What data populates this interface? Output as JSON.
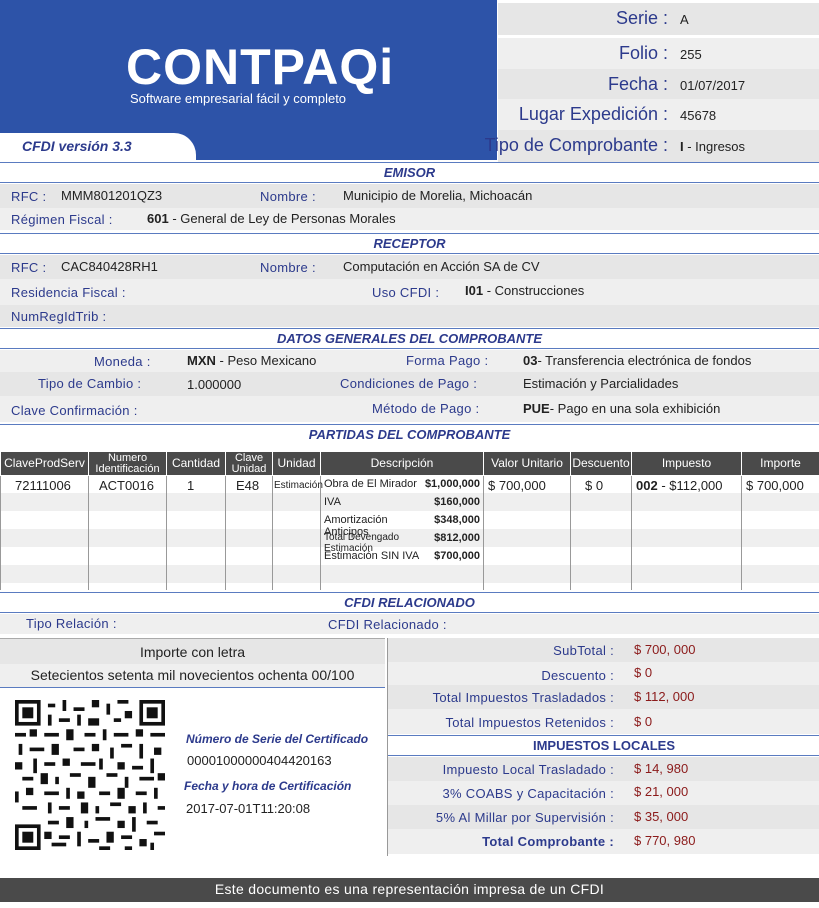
{
  "header": {
    "logo": "CONTPAQi",
    "tagline": "Software empresarial fácil y completo",
    "cfdi_version": "CFDI versión 3.3",
    "fields": [
      {
        "label": "Serie :",
        "value": "A"
      },
      {
        "label": "Folio :",
        "value": "255"
      },
      {
        "label": "Fecha :",
        "value": "01/07/2017"
      },
      {
        "label": "Lugar Expedición :",
        "value": "45678"
      },
      {
        "label": "Tipo de Comprobante :",
        "value_code": "I",
        "value": " - Ingresos"
      }
    ]
  },
  "emisor": {
    "title": "EMISOR",
    "rfc_label": "RFC :",
    "rfc": "MMM801201QZ3",
    "nombre_label": "Nombre :",
    "nombre": "Municipio de Morelia, Michoacán",
    "regimen_label": "Régimen Fiscal :",
    "regimen_code": "601",
    "regimen": " - General de Ley de Personas Morales"
  },
  "receptor": {
    "title": "RECEPTOR",
    "rfc_label": "RFC :",
    "rfc": "CAC840428RH1",
    "nombre_label": "Nombre :",
    "nombre": "Computación en Acción SA de CV",
    "residencia_label": "Residencia Fiscal :",
    "uso_label": "Uso CFDI :",
    "uso_code": "I01",
    "uso": " - Construcciones",
    "numreg_label": "NumRegIdTrib :"
  },
  "datos_generales": {
    "title": "DATOS GENERALES DEL COMPROBANTE",
    "moneda_label": "Moneda :",
    "moneda_code": "MXN",
    "moneda": " - Peso Mexicano",
    "forma_label": "Forma Pago :",
    "forma_code": "03",
    "forma": "- Transferencia electrónica de fondos",
    "tipo_cambio_label": "Tipo de Cambio :",
    "tipo_cambio": "1.000000",
    "condiciones_label": "Condiciones de Pago :",
    "condiciones": "Estimación y Parcialidades",
    "clave_label": "Clave Confirmación :",
    "metodo_label": "Método de Pago :",
    "metodo_code": "PUE",
    "metodo": "- Pago en una sola exhibición"
  },
  "partidas": {
    "title": "PARTIDAS DEL COMPROBANTE",
    "columns": [
      "ClaveProdServ",
      "Numero Identificación",
      "Cantidad",
      "Clave Unidad",
      "Unidad",
      "Descripción",
      "Valor Unitario",
      "Descuento",
      "Impuesto",
      "Importe"
    ],
    "row": {
      "clave": "72111006",
      "numero": "ACT0016",
      "cantidad": "1",
      "clave_unidad": "E48",
      "unidad": "Estimación",
      "descripcion": [
        {
          "label": "Obra de El Mirador",
          "amount": "$1,000,000"
        },
        {
          "label": "IVA",
          "amount": "$160,000"
        },
        {
          "label": "Amortización Anticipos",
          "amount": "$348,000"
        },
        {
          "label": "Total Devengado Estimación",
          "amount": "$812,000"
        },
        {
          "label": "Estimación SIN IVA",
          "amount": "$700,000"
        }
      ],
      "valor_unitario": "$ 700,000",
      "descuento": "$ 0",
      "impuesto_code": "002",
      "impuesto": " -   $112,000",
      "importe": "$ 700,000"
    }
  },
  "relacionado": {
    "title": "CFDI RELACIONADO",
    "tipo_label": "Tipo Relación :",
    "cfdi_label": "CFDI Relacionado :"
  },
  "importe_letra": {
    "title": "Importe con letra",
    "value": "Setecientos setenta mil novecientos ochenta 00/100"
  },
  "certificado": {
    "serie_label": "Número de Serie del Certificado",
    "serie": "00001000000404420163",
    "fecha_label": "Fecha y hora de Certificación",
    "fecha": "2017-07-01T11:20:08"
  },
  "totales": [
    {
      "label": "SubTotal :",
      "value": "$ 700, 000"
    },
    {
      "label": "Descuento :",
      "value": "$ 0"
    },
    {
      "label": "Total Impuestos Trasladados :",
      "value": "$ 112, 000"
    },
    {
      "label": "Total Impuestos Retenidos :",
      "value": "$ 0"
    }
  ],
  "locales": {
    "title": "IMPUESTOS LOCALES",
    "items": [
      {
        "label": "Impuesto Local Trasladado :",
        "value": "$ 14, 980"
      },
      {
        "label": "3% COABS y Capacitación :",
        "value": "$ 21, 000"
      },
      {
        "label": "5% Al Millar por Supervisión :",
        "value": "$ 35, 000"
      }
    ],
    "total_label": "Total Comprobante :",
    "total": "$ 770, 980"
  },
  "footer": "Este documento es una representación impresa de un CFDI",
  "colors": {
    "brand_blue": "#2d53a8",
    "label_navy": "#2c3a8c",
    "amount_red": "#8b1a1a",
    "footer_grey": "#4a4a4a"
  }
}
